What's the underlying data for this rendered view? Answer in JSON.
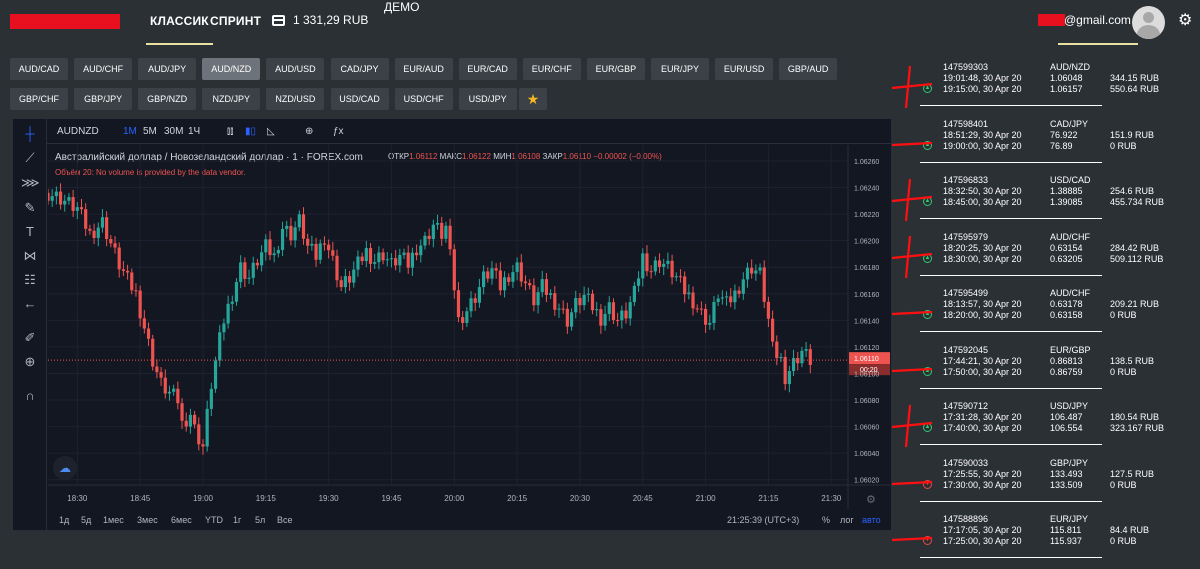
{
  "header": {
    "tabs": [
      {
        "label": "КЛАССИК",
        "active": true
      },
      {
        "label": "СПРИНТ",
        "active": false
      }
    ],
    "balance": "1 331,29 RUB",
    "mode": "ДЕМО",
    "email": "@gmail.com",
    "accent": "#e8e0a0"
  },
  "pairs": {
    "row1": [
      "AUD/CAD",
      "AUD/CHF",
      "AUD/JPY",
      "AUD/NZD",
      "AUD/USD",
      "CAD/JPY",
      "EUR/AUD",
      "EUR/CAD",
      "EUR/CHF",
      "EUR/GBP",
      "EUR/JPY",
      "EUR/USD",
      "GBP/AUD"
    ],
    "row2": [
      "GBP/CHF",
      "GBP/JPY",
      "GBP/NZD",
      "NZD/JPY",
      "NZD/USD",
      "USD/CAD",
      "USD/CHF",
      "USD/JPY"
    ],
    "selected": "AUD/NZD",
    "favorites_icon": "star-icon"
  },
  "chart": {
    "symbol": "AUDNZD",
    "intervals": [
      "1M",
      "5M",
      "30M",
      "1Ч"
    ],
    "active_interval": "1M",
    "title": "Австралийский доллар / Новозеландский доллар · 1 · FOREX.com",
    "ohlc": {
      "o_label": "ОТКР",
      "o": "1.06112",
      "h_label": "МАКС",
      "h": "1.06122",
      "l_label": "МИН",
      "l": "1.06108",
      "c_label": "ЗАКР",
      "c": "1.06110",
      "chg": "−0.00002 (−0.00%)"
    },
    "volume_note": "Объём 20: No volume is provided by the data vendor.",
    "ranges": [
      "1д",
      "5д",
      "1мес",
      "3мес",
      "6мес",
      "YTD",
      "1г",
      "5л",
      "Все"
    ],
    "clock": "21:25:39 (UTC+3)",
    "scale_opts": [
      "%",
      "лог",
      "авто"
    ],
    "price_label": "1.06110",
    "countdown": "00:20",
    "colors": {
      "up": "#26a69a",
      "down": "#ef5350",
      "bg": "#131722"
    }
  },
  "chart_data": {
    "type": "candlestick",
    "symbol": "AUDNZD",
    "x_ticks": [
      "18:30",
      "18:45",
      "19:00",
      "19:15",
      "19:30",
      "19:45",
      "20:00",
      "20:15",
      "20:30",
      "20:45",
      "21:00",
      "21:15",
      "21:30"
    ],
    "y_ticks": [
      "1.06260",
      "1.06240",
      "1.06220",
      "1.06200",
      "1.06180",
      "1.06160",
      "1.06140",
      "1.06120",
      "1.06100",
      "1.06080",
      "1.06060",
      "1.06040",
      "1.06020"
    ],
    "ylim": [
      1.06016,
      1.06272
    ],
    "x_start": "18:23",
    "x_end": "21:34",
    "current_price": 1.0611,
    "close_path": [
      [
        "18:23",
        1.06236
      ],
      [
        "18:26",
        1.06232
      ],
      [
        "18:30",
        1.06224
      ],
      [
        "18:33",
        1.06205
      ],
      [
        "18:36",
        1.06214
      ],
      [
        "18:38",
        1.06198
      ],
      [
        "18:40",
        1.06182
      ],
      [
        "18:42",
        1.0617
      ],
      [
        "18:44",
        1.0616
      ],
      [
        "18:46",
        1.06135
      ],
      [
        "18:48",
        1.0611
      ],
      [
        "18:50",
        1.06092
      ],
      [
        "18:52",
        1.06085
      ],
      [
        "18:54",
        1.0608
      ],
      [
        "18:55",
        1.06062
      ],
      [
        "18:57",
        1.0607
      ],
      [
        "18:58",
        1.06058
      ],
      [
        "19:00",
        1.06045
      ],
      [
        "19:02",
        1.06092
      ],
      [
        "19:04",
        1.06125
      ],
      [
        "19:05",
        1.0614
      ],
      [
        "19:07",
        1.0616
      ],
      [
        "19:09",
        1.0618
      ],
      [
        "19:11",
        1.06172
      ],
      [
        "19:13",
        1.06185
      ],
      [
        "19:15",
        1.06195
      ],
      [
        "19:17",
        1.06188
      ],
      [
        "19:19",
        1.0621
      ],
      [
        "19:21",
        1.06205
      ],
      [
        "19:23",
        1.06215
      ],
      [
        "19:25",
        1.06195
      ],
      [
        "19:27",
        1.06188
      ],
      [
        "19:29",
        1.06203
      ],
      [
        "19:31",
        1.06185
      ],
      [
        "19:33",
        1.06165
      ],
      [
        "19:35",
        1.06172
      ],
      [
        "19:37",
        1.06182
      ],
      [
        "19:39",
        1.06192
      ],
      [
        "19:41",
        1.06185
      ],
      [
        "19:43",
        1.0619
      ],
      [
        "19:45",
        1.06182
      ],
      [
        "19:47",
        1.06188
      ],
      [
        "19:49",
        1.06182
      ],
      [
        "19:51",
        1.06195
      ],
      [
        "19:53",
        1.062
      ],
      [
        "19:55",
        1.06212
      ],
      [
        "19:57",
        1.06205
      ],
      [
        "19:58",
        1.0621
      ],
      [
        "20:00",
        1.06165
      ],
      [
        "20:01",
        1.0614
      ],
      [
        "20:03",
        1.06148
      ],
      [
        "20:05",
        1.06158
      ],
      [
        "20:07",
        1.06172
      ],
      [
        "20:09",
        1.06178
      ],
      [
        "20:11",
        1.06165
      ],
      [
        "20:13",
        1.06175
      ],
      [
        "20:15",
        1.0618
      ],
      [
        "20:17",
        1.06168
      ],
      [
        "20:19",
        1.06155
      ],
      [
        "20:21",
        1.06165
      ],
      [
        "20:23",
        1.06158
      ],
      [
        "20:25",
        1.0615
      ],
      [
        "20:27",
        1.0614
      ],
      [
        "20:29",
        1.06152
      ],
      [
        "20:31",
        1.06158
      ],
      [
        "20:33",
        1.0615
      ],
      [
        "20:35",
        1.06142
      ],
      [
        "20:37",
        1.0615
      ],
      [
        "20:39",
        1.0614
      ],
      [
        "20:41",
        1.06145
      ],
      [
        "20:43",
        1.0616
      ],
      [
        "20:45",
        1.06188
      ],
      [
        "20:47",
        1.06178
      ],
      [
        "20:49",
        1.06185
      ],
      [
        "20:51",
        1.0618
      ],
      [
        "20:53",
        1.06172
      ],
      [
        "20:55",
        1.06162
      ],
      [
        "20:57",
        1.06155
      ],
      [
        "20:59",
        1.06145
      ],
      [
        "21:01",
        1.06138
      ],
      [
        "21:03",
        1.0616
      ],
      [
        "21:05",
        1.06152
      ],
      [
        "21:07",
        1.0616
      ],
      [
        "21:09",
        1.06172
      ],
      [
        "21:11",
        1.0618
      ],
      [
        "21:13",
        1.06175
      ],
      [
        "21:15",
        1.0614
      ],
      [
        "21:16",
        1.06118
      ],
      [
        "21:18",
        1.0611
      ],
      [
        "21:19",
        1.06098
      ],
      [
        "21:21",
        1.06108
      ],
      [
        "21:23",
        1.06117
      ],
      [
        "21:25",
        1.0611
      ]
    ]
  },
  "trades": [
    {
      "id": "147599303",
      "open_time": "19:01:48, 30 Apr 20",
      "close_time": "19:15:00, 30 Apr 20",
      "pair": "AUD/NZD",
      "open_price": "1.06048",
      "close_price": "1.06157",
      "stake": "344.15 RUB",
      "payout": "550.64 RUB",
      "direction": "up",
      "mark": "cross"
    },
    {
      "id": "147598401",
      "open_time": "18:51:29, 30 Apr 20",
      "close_time": "19:00:00, 30 Apr 20",
      "pair": "CAD/JPY",
      "open_price": "76.922",
      "close_price": "76.89",
      "stake": "151.9 RUB",
      "payout": "0 RUB",
      "direction": "up",
      "mark": "dash"
    },
    {
      "id": "147596833",
      "open_time": "18:32:50, 30 Apr 20",
      "close_time": "18:45:00, 30 Apr 20",
      "pair": "USD/CAD",
      "open_price": "1.38885",
      "close_price": "1.39085",
      "stake": "254.6 RUB",
      "payout": "455.734 RUB",
      "direction": "up",
      "mark": "cross"
    },
    {
      "id": "147595979",
      "open_time": "18:20:25, 30 Apr 20",
      "close_time": "18:30:00, 30 Apr 20",
      "pair": "AUD/CHF",
      "open_price": "0.63154",
      "close_price": "0.63205",
      "stake": "284.42 RUB",
      "payout": "509.112 RUB",
      "direction": "up",
      "mark": "cross"
    },
    {
      "id": "147595499",
      "open_time": "18:13:57, 30 Apr 20",
      "close_time": "18:20:00, 30 Apr 20",
      "pair": "AUD/CHF",
      "open_price": "0.63178",
      "close_price": "0.63158",
      "stake": "209.21 RUB",
      "payout": "0 RUB",
      "direction": "up",
      "mark": "dash"
    },
    {
      "id": "147592045",
      "open_time": "17:44:21, 30 Apr 20",
      "close_time": "17:50:00, 30 Apr 20",
      "pair": "EUR/GBP",
      "open_price": "0.86813",
      "close_price": "0.86759",
      "stake": "138.5 RUB",
      "payout": "0 RUB",
      "direction": "up",
      "mark": "dash"
    },
    {
      "id": "147590712",
      "open_time": "17:31:28, 30 Apr 20",
      "close_time": "17:40:00, 30 Apr 20",
      "pair": "USD/JPY",
      "open_price": "106.487",
      "close_price": "106.554",
      "stake": "180.54 RUB",
      "payout": "323.167 RUB",
      "direction": "up",
      "mark": "cross"
    },
    {
      "id": "147590033",
      "open_time": "17:25:55, 30 Apr 20",
      "close_time": "17:30:00, 30 Apr 20",
      "pair": "GBP/JPY",
      "open_price": "133.493",
      "close_price": "133.509",
      "stake": "127.5 RUB",
      "payout": "0 RUB",
      "direction": "down",
      "mark": "dash"
    },
    {
      "id": "147588896",
      "open_time": "17:17:05, 30 Apr 20",
      "close_time": "17:25:00, 30 Apr 20",
      "pair": "EUR/JPY",
      "open_price": "115.811",
      "close_price": "115.937",
      "stake": "84.4 RUB",
      "payout": "0 RUB",
      "direction": "down",
      "mark": "dash"
    }
  ]
}
